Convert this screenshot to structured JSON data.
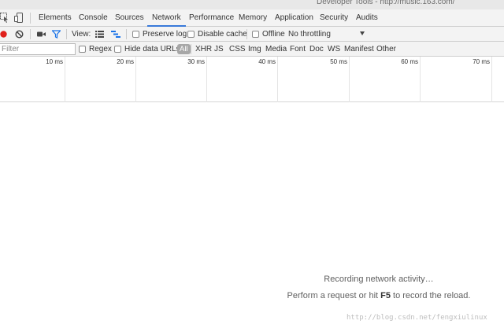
{
  "window": {
    "title": "Developer Tools - http://music.163.com/"
  },
  "tabs": [
    {
      "label": "Elements"
    },
    {
      "label": "Console"
    },
    {
      "label": "Sources"
    },
    {
      "label": "Network",
      "active": true
    },
    {
      "label": "Performance"
    },
    {
      "label": "Memory"
    },
    {
      "label": "Application"
    },
    {
      "label": "Security"
    },
    {
      "label": "Audits"
    }
  ],
  "toolbar": {
    "view_label": "View:",
    "preserve_log": {
      "label": "Preserve log",
      "checked": false
    },
    "disable_cache": {
      "label": "Disable cache",
      "checked": false
    },
    "offline": {
      "label": "Offline",
      "checked": false
    },
    "throttling": "No throttling"
  },
  "filterbar": {
    "filter_placeholder": "Filter",
    "regex": {
      "label": "Regex",
      "checked": false
    },
    "hide_data_urls": {
      "label": "Hide data URLs",
      "checked": false
    },
    "types": [
      "All",
      "XHR",
      "JS",
      "CSS",
      "Img",
      "Media",
      "Font",
      "Doc",
      "WS",
      "Manifest",
      "Other"
    ],
    "selected_type": "All"
  },
  "timeline": {
    "ticks": [
      "10 ms",
      "20 ms",
      "30 ms",
      "40 ms",
      "50 ms",
      "60 ms",
      "70 ms"
    ]
  },
  "empty_state": {
    "line1": "Recording network activity…",
    "line2_prefix": "Perform a request or hit ",
    "line2_key": "F5",
    "line2_suffix": " to record the reload."
  },
  "watermark": "http://blog.csdn.net/fengxiulinux",
  "colors": {
    "record": "#e0201b",
    "accent": "#3879d9",
    "filter_icon": "#1a73e8"
  }
}
